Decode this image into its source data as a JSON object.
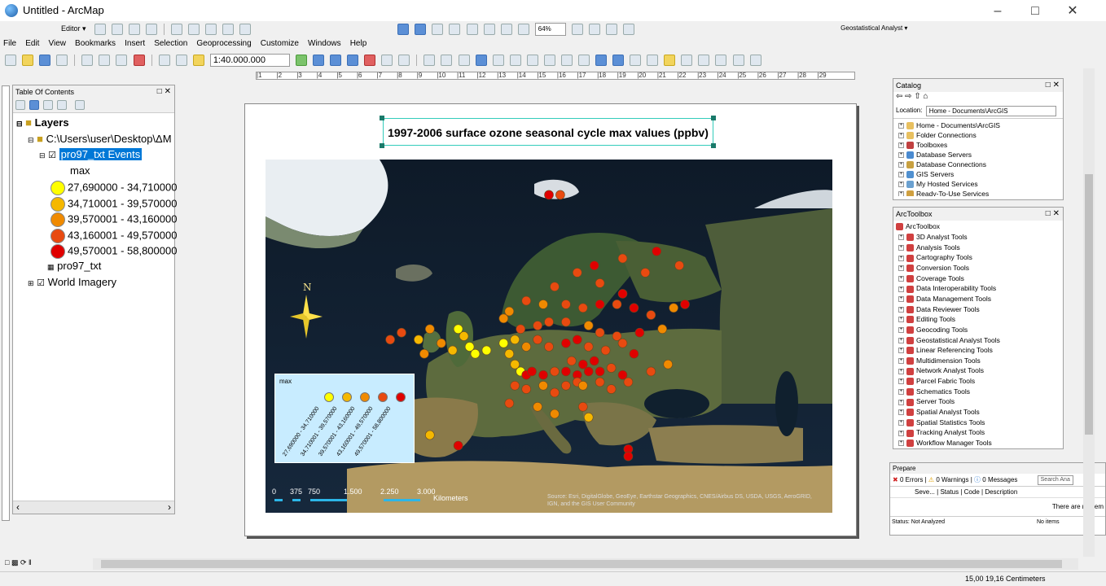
{
  "window": {
    "title": "Untitled - ArcMap"
  },
  "toolbars": {
    "editor_label": "Editor ▾",
    "scale": "1:40.000.000",
    "zoom": "64%",
    "geostat": "Geostatistical Analyst ▾"
  },
  "menu": [
    "File",
    "Edit",
    "View",
    "Bookmarks",
    "Insert",
    "Selection",
    "Geoprocessing",
    "Customize",
    "Windows",
    "Help"
  ],
  "ruler_ticks": [
    "1",
    "2",
    "3",
    "4",
    "5",
    "6",
    "7",
    "8",
    "9",
    "10",
    "11",
    "12",
    "13",
    "14",
    "15",
    "16",
    "17",
    "18",
    "19",
    "20",
    "21",
    "22",
    "23",
    "24",
    "25",
    "26",
    "27",
    "28",
    "29"
  ],
  "toc": {
    "title": "Table Of Contents",
    "layers_label": "Layers",
    "folder": "C:\\Users\\user\\Desktop\\ΔM",
    "layer": "pro97_txt Events",
    "field": "max",
    "classes": [
      {
        "label": "27,690000 - 34,710000",
        "color": "#ffff00"
      },
      {
        "label": "34,710001 - 39,570000",
        "color": "#f5b800"
      },
      {
        "label": "39,570001 - 43,160000",
        "color": "#f08a00"
      },
      {
        "label": "43,160001 - 49,570000",
        "color": "#e84a10"
      },
      {
        "label": "49,570001 - 58,800000",
        "color": "#e00000"
      }
    ],
    "table": "pro97_txt",
    "basemap": "World Imagery"
  },
  "layout": {
    "title": "1997-2006 surface ozone seasonal cycle max values (ppbv)",
    "legend_title": "max",
    "legend_classes": [
      "27,690000 - 34,710000",
      "34,710001 - 39,570000",
      "39,570001 - 43,160000",
      "43,160001 - 49,570000",
      "49,570001 - 58,800000"
    ],
    "north": "N",
    "scale_labels": [
      "0",
      "375",
      "750",
      "1.500",
      "2.250",
      "3.000"
    ],
    "scale_unit": "Kilometers",
    "credits": "Source: Esri, DigitalGlobe, GeoEye, Earthstar Geographics, CNES/Airbus DS, USDA, USGS, AeroGRID, IGN, and the GIS User Community"
  },
  "catalog": {
    "title": "Catalog",
    "location_label": "Location:",
    "location_value": "Home - Documents\\ArcGIS",
    "items": [
      "Home - Documents\\ArcGIS",
      "Folder Connections",
      "Toolboxes",
      "Database Servers",
      "Database Connections",
      "GIS Servers",
      "My Hosted Services",
      "Ready-To-Use Services"
    ]
  },
  "toolbox": {
    "title": "ArcToolbox",
    "root": "ArcToolbox",
    "items": [
      "3D Analyst Tools",
      "Analysis Tools",
      "Cartography Tools",
      "Conversion Tools",
      "Coverage Tools",
      "Data Interoperability Tools",
      "Data Management Tools",
      "Data Reviewer Tools",
      "Editing Tools",
      "Geocoding Tools",
      "Geostatistical Analyst Tools",
      "Linear Referencing Tools",
      "Multidimension Tools",
      "Network Analyst Tools",
      "Parcel Fabric Tools",
      "Schematics Tools",
      "Server Tools",
      "Spatial Analyst Tools",
      "Spatial Statistics Tools",
      "Tracking Analyst Tools",
      "Workflow Manager Tools"
    ]
  },
  "prepare": {
    "title": "Prepare",
    "errors": "0 Errors",
    "warnings": "0 Warnings",
    "messages": "0 Messages",
    "search": "Search Ana",
    "cols": [
      "Seve...",
      "Status",
      "Code",
      "Description"
    ],
    "empty": "There are no item",
    "status": "Status: Not Analyzed",
    "items": "No items"
  },
  "status": {
    "coords": "15,00  19,16 Centimeters"
  },
  "points": [
    {
      "x": 0.5,
      "y": 0.1,
      "c": 4
    },
    {
      "x": 0.52,
      "y": 0.1,
      "c": 3
    },
    {
      "x": 0.55,
      "y": 0.32,
      "c": 3
    },
    {
      "x": 0.58,
      "y": 0.3,
      "c": 4
    },
    {
      "x": 0.63,
      "y": 0.28,
      "c": 3
    },
    {
      "x": 0.69,
      "y": 0.26,
      "c": 4
    },
    {
      "x": 0.73,
      "y": 0.3,
      "c": 3
    },
    {
      "x": 0.67,
      "y": 0.32,
      "c": 3
    },
    {
      "x": 0.59,
      "y": 0.35,
      "c": 3
    },
    {
      "x": 0.63,
      "y": 0.38,
      "c": 4
    },
    {
      "x": 0.51,
      "y": 0.36,
      "c": 3
    },
    {
      "x": 0.46,
      "y": 0.4,
      "c": 3
    },
    {
      "x": 0.43,
      "y": 0.43,
      "c": 2
    },
    {
      "x": 0.49,
      "y": 0.41,
      "c": 2
    },
    {
      "x": 0.53,
      "y": 0.41,
      "c": 3
    },
    {
      "x": 0.56,
      "y": 0.42,
      "c": 3
    },
    {
      "x": 0.59,
      "y": 0.41,
      "c": 4
    },
    {
      "x": 0.62,
      "y": 0.41,
      "c": 3
    },
    {
      "x": 0.65,
      "y": 0.42,
      "c": 4
    },
    {
      "x": 0.68,
      "y": 0.44,
      "c": 3
    },
    {
      "x": 0.72,
      "y": 0.42,
      "c": 2
    },
    {
      "x": 0.74,
      "y": 0.41,
      "c": 4
    },
    {
      "x": 0.42,
      "y": 0.45,
      "c": 2
    },
    {
      "x": 0.45,
      "y": 0.48,
      "c": 3
    },
    {
      "x": 0.48,
      "y": 0.47,
      "c": 3
    },
    {
      "x": 0.5,
      "y": 0.46,
      "c": 3
    },
    {
      "x": 0.53,
      "y": 0.46,
      "c": 3
    },
    {
      "x": 0.57,
      "y": 0.47,
      "c": 2
    },
    {
      "x": 0.59,
      "y": 0.49,
      "c": 3
    },
    {
      "x": 0.62,
      "y": 0.5,
      "c": 3
    },
    {
      "x": 0.66,
      "y": 0.49,
      "c": 4
    },
    {
      "x": 0.7,
      "y": 0.48,
      "c": 2
    },
    {
      "x": 0.27,
      "y": 0.51,
      "c": 1
    },
    {
      "x": 0.29,
      "y": 0.48,
      "c": 2
    },
    {
      "x": 0.34,
      "y": 0.48,
      "c": 0
    },
    {
      "x": 0.35,
      "y": 0.5,
      "c": 1
    },
    {
      "x": 0.36,
      "y": 0.53,
      "c": 0
    },
    {
      "x": 0.33,
      "y": 0.54,
      "c": 1
    },
    {
      "x": 0.37,
      "y": 0.55,
      "c": 0
    },
    {
      "x": 0.39,
      "y": 0.54,
      "c": 0
    },
    {
      "x": 0.31,
      "y": 0.52,
      "c": 2
    },
    {
      "x": 0.28,
      "y": 0.55,
      "c": 2
    },
    {
      "x": 0.22,
      "y": 0.51,
      "c": 3
    },
    {
      "x": 0.24,
      "y": 0.49,
      "c": 3
    },
    {
      "x": 0.42,
      "y": 0.52,
      "c": 0
    },
    {
      "x": 0.43,
      "y": 0.55,
      "c": 1
    },
    {
      "x": 0.44,
      "y": 0.51,
      "c": 1
    },
    {
      "x": 0.46,
      "y": 0.53,
      "c": 2
    },
    {
      "x": 0.48,
      "y": 0.51,
      "c": 3
    },
    {
      "x": 0.5,
      "y": 0.53,
      "c": 3
    },
    {
      "x": 0.53,
      "y": 0.52,
      "c": 4
    },
    {
      "x": 0.55,
      "y": 0.51,
      "c": 4
    },
    {
      "x": 0.57,
      "y": 0.53,
      "c": 3
    },
    {
      "x": 0.6,
      "y": 0.54,
      "c": 3
    },
    {
      "x": 0.63,
      "y": 0.52,
      "c": 3
    },
    {
      "x": 0.65,
      "y": 0.55,
      "c": 4
    },
    {
      "x": 0.44,
      "y": 0.58,
      "c": 1
    },
    {
      "x": 0.45,
      "y": 0.6,
      "c": 0
    },
    {
      "x": 0.46,
      "y": 0.61,
      "c": 4
    },
    {
      "x": 0.47,
      "y": 0.6,
      "c": 4
    },
    {
      "x": 0.49,
      "y": 0.61,
      "c": 4
    },
    {
      "x": 0.51,
      "y": 0.6,
      "c": 3
    },
    {
      "x": 0.53,
      "y": 0.6,
      "c": 4
    },
    {
      "x": 0.55,
      "y": 0.61,
      "c": 4
    },
    {
      "x": 0.57,
      "y": 0.6,
      "c": 4
    },
    {
      "x": 0.59,
      "y": 0.6,
      "c": 4
    },
    {
      "x": 0.61,
      "y": 0.59,
      "c": 3
    },
    {
      "x": 0.63,
      "y": 0.61,
      "c": 4
    },
    {
      "x": 0.56,
      "y": 0.58,
      "c": 4
    },
    {
      "x": 0.54,
      "y": 0.57,
      "c": 3
    },
    {
      "x": 0.58,
      "y": 0.57,
      "c": 4
    },
    {
      "x": 0.44,
      "y": 0.64,
      "c": 3
    },
    {
      "x": 0.46,
      "y": 0.65,
      "c": 3
    },
    {
      "x": 0.49,
      "y": 0.64,
      "c": 2
    },
    {
      "x": 0.51,
      "y": 0.66,
      "c": 3
    },
    {
      "x": 0.53,
      "y": 0.64,
      "c": 3
    },
    {
      "x": 0.55,
      "y": 0.63,
      "c": 3
    },
    {
      "x": 0.56,
      "y": 0.64,
      "c": 2
    },
    {
      "x": 0.59,
      "y": 0.63,
      "c": 3
    },
    {
      "x": 0.61,
      "y": 0.65,
      "c": 3
    },
    {
      "x": 0.64,
      "y": 0.63,
      "c": 3
    },
    {
      "x": 0.68,
      "y": 0.6,
      "c": 3
    },
    {
      "x": 0.71,
      "y": 0.58,
      "c": 2
    },
    {
      "x": 0.43,
      "y": 0.69,
      "c": 3
    },
    {
      "x": 0.48,
      "y": 0.7,
      "c": 2
    },
    {
      "x": 0.51,
      "y": 0.72,
      "c": 2
    },
    {
      "x": 0.56,
      "y": 0.7,
      "c": 3
    },
    {
      "x": 0.57,
      "y": 0.73,
      "c": 1
    },
    {
      "x": 0.29,
      "y": 0.78,
      "c": 1
    },
    {
      "x": 0.34,
      "y": 0.81,
      "c": 4
    },
    {
      "x": 0.64,
      "y": 0.82,
      "c": 4
    },
    {
      "x": 0.64,
      "y": 0.84,
      "c": 4
    }
  ]
}
